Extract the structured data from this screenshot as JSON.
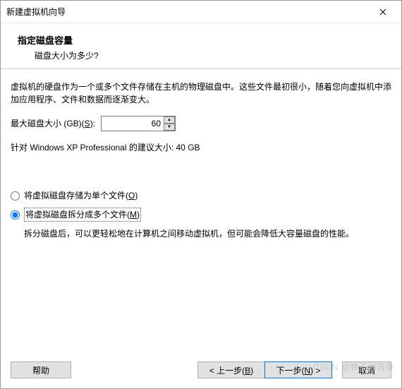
{
  "window": {
    "title": "新建虚拟机向导"
  },
  "header": {
    "title": "指定磁盘容量",
    "subtitle": "磁盘大小为多少?"
  },
  "content": {
    "description": "虚拟机的硬盘作为一个或多个文件存储在主机的物理磁盘中。这些文件最初很小，随着您向虚拟机中添加应用程序、文件和数据而逐渐变大。",
    "max_size_label_prefix": "最大磁盘大小 (GB)(",
    "max_size_label_accel": "S",
    "max_size_label_suffix": "):",
    "max_size_value": "60",
    "suggested": "针对 Windows XP Professional 的建议大小: 40 GB",
    "radio": {
      "single": {
        "prefix": "将虚拟磁盘存储为单个文件(",
        "accel": "O",
        "suffix": ")",
        "checked": false
      },
      "split": {
        "prefix": "将虚拟磁盘拆分成多个文件(",
        "accel": "M",
        "suffix": ")",
        "checked": true,
        "desc": "拆分磁盘后，可以更轻松地在计算机之间移动虚拟机，但可能会降低大容量磁盘的性能。"
      }
    }
  },
  "footer": {
    "help": "帮助",
    "back_prefix": "< 上一步(",
    "back_accel": "B",
    "back_suffix": ")",
    "next_prefix": "下一步(",
    "next_accel": "N",
    "next_suffix": ") >",
    "cancel": "取消"
  },
  "watermark": "CSDN @魏子林哥哥"
}
